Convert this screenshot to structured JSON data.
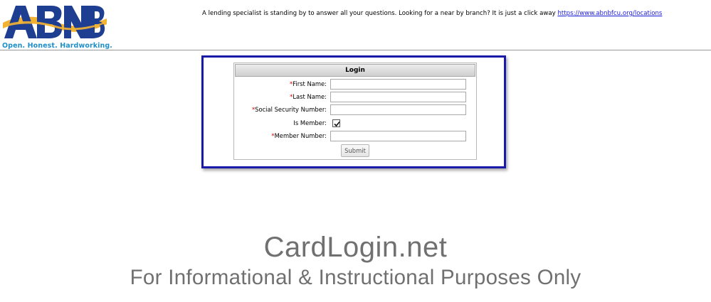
{
  "header": {
    "logo_text": "ABNB",
    "tagline": "Open. Honest. Hardworking.",
    "notice_text": "A lending specialist is standing by to answer all your questions. Looking for a near by branch? It is just a click away",
    "notice_link": "https://www.abnbfcu.org/locations"
  },
  "login": {
    "title": "Login",
    "required_marker": "*",
    "fields": [
      {
        "label": "First Name:",
        "required": true,
        "type": "text",
        "value": ""
      },
      {
        "label": "Last Name:",
        "required": true,
        "type": "text",
        "value": ""
      },
      {
        "label": "Social Security Number:",
        "required": true,
        "type": "text",
        "value": ""
      },
      {
        "label": "Is Member:",
        "required": false,
        "type": "checkbox",
        "checked": true
      },
      {
        "label": "Member Number:",
        "required": true,
        "type": "text",
        "value": ""
      }
    ],
    "submit_label": "Submit"
  },
  "watermark": {
    "title": "CardLogin.net",
    "subtitle": "For Informational & Instructional Purposes Only"
  },
  "colors": {
    "logo_blue": "#1e3e92",
    "logo_gold": "#f2b233",
    "tagline_blue": "#1f8fc9",
    "highlight_border": "#1a1aa8",
    "required_red": "#cc0000",
    "link_blue": "#1a1ad6",
    "watermark_gray": "#707070"
  }
}
